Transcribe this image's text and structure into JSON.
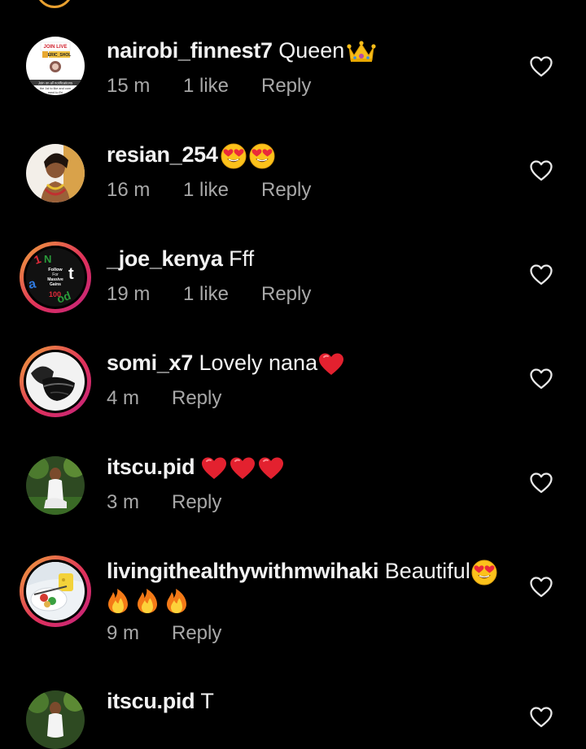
{
  "comments": [
    {
      "username": "nairobi_finnest7",
      "text": " Queen",
      "emoji": [
        "crown"
      ],
      "time": "15 m",
      "likes": "1 like",
      "reply": "Reply",
      "avatar_text": {
        "top": "JOIN LIVE",
        "name": "ERIC_SHOL",
        "line1": "Join on all notifications",
        "line2": "the 1st to like and com",
        "line3": "ment to Eri"
      }
    },
    {
      "username": "resian_254",
      "text": "",
      "emoji": [
        "heart-eyes",
        "heart-eyes"
      ],
      "time": "16 m",
      "likes": "1 like",
      "reply": "Reply"
    },
    {
      "username": "_joe_kenya",
      "text": " Fff",
      "emoji": [],
      "time": "19 m",
      "likes": "1 like",
      "reply": "Reply",
      "avatar_text": {
        "a": "Follow",
        "b": "For",
        "c": "Massive",
        "d": "Gains"
      }
    },
    {
      "username": "somi_x7",
      "text": " Lovely nana",
      "emoji": [
        "red-heart"
      ],
      "time": "4 m",
      "likes": "",
      "reply": "Reply"
    },
    {
      "username": "itscu.pid",
      "text": "",
      "emoji": [
        "red-heart",
        "red-heart",
        "red-heart"
      ],
      "time": "3 m",
      "likes": "",
      "reply": "Reply"
    },
    {
      "username": "livingithealthywithmwihaki",
      "text": " Beautiful",
      "emoji": [
        "heart-eyes"
      ],
      "emoji_line2": [
        "fire",
        "fire",
        "fire"
      ],
      "time": "9 m",
      "likes": "",
      "reply": "Reply"
    },
    {
      "username": "itscu.pid",
      "text": " T",
      "emoji": [],
      "time": "",
      "likes": "",
      "reply": ""
    }
  ],
  "colors": {
    "background": "#000000",
    "text": "#f2f2f2",
    "meta": "#a8a8a8",
    "ring_start": "#f0a63a",
    "ring_end": "#c2237e"
  }
}
